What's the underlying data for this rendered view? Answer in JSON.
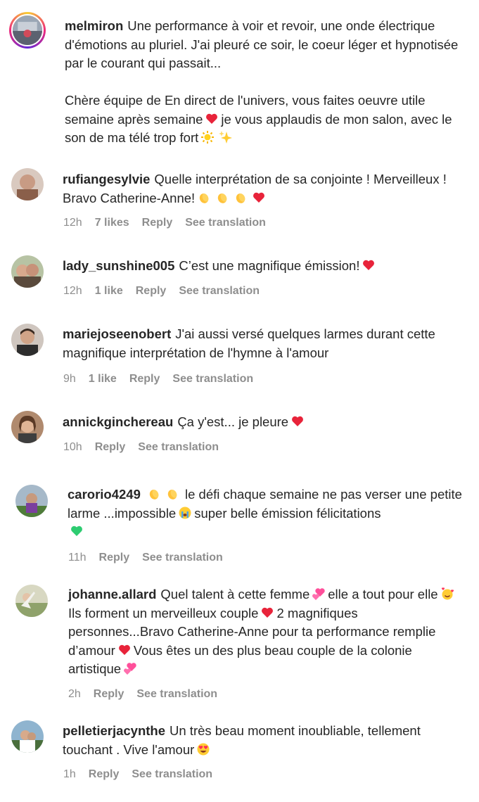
{
  "comments": [
    {
      "username": "melmiron",
      "text_1": "Une performance à voir et revoir, une onde électrique d'émotions au pluriel. J'ai pleuré ce soir, le coeur léger et hypnotisée par le courant qui passait...",
      "text_2": "Chère équipe de En direct de l'univers, vous faites oeuvre utile semaine après semaine",
      "text_3": "je vous applaudis de mon salon, avec le son de ma télé trop fort",
      "emojis": [
        "red-heart",
        "sun",
        "sparkles"
      ]
    },
    {
      "username": "rufiangesylvie",
      "text_1": "Quelle interprétation de sa conjointe ! Merveilleux ! Bravo Catherine-Anne!",
      "emojis": [
        "clapping-hands",
        "clapping-hands",
        "clapping-hands",
        "red-heart"
      ],
      "time": "12h",
      "likes": "7 likes",
      "reply": "Reply",
      "translate": "See translation"
    },
    {
      "username": "lady_sunshine005",
      "text_1": "C’est une magnifique émission!",
      "emojis": [
        "red-heart"
      ],
      "time": "12h",
      "likes": "1 like",
      "reply": "Reply",
      "translate": "See translation"
    },
    {
      "username": "mariejoseenobert",
      "text_1": "J'ai aussi versé quelques larmes durant cette magnifique interprétation de l'hymne à l'amour",
      "time": "9h",
      "likes": "1 like",
      "reply": "Reply",
      "translate": "See translation"
    },
    {
      "username": "annickginchereau",
      "text_1": "Ça y'est... je pleure",
      "emojis": [
        "red-heart"
      ],
      "time": "10h",
      "reply": "Reply",
      "translate": "See translation"
    },
    {
      "username": "carorio4249",
      "text_1": "le défi chaque semaine ne pas verser une petite larme ...impossible",
      "text_2": "super belle émission félicitations",
      "emojis": [
        "clapping-hands",
        "clapping-hands",
        "crying-face",
        "green-heart"
      ],
      "time": "11h",
      "reply": "Reply",
      "translate": "See translation"
    },
    {
      "username": "johanne.allard",
      "text_1": "Quel talent à cette femme",
      "text_2": "elle a tout pour elle",
      "text_3": "Ils forment un merveilleux couple",
      "text_4": "2 magnifiques personnes...Bravo Catherine-Anne pour ta performance remplie d’amour",
      "text_5": "Vous êtes un des plus beau couple de la colonie artistique",
      "emojis": [
        "two-hearts",
        "smiling-face-with-hearts",
        "red-heart",
        "red-heart",
        "two-hearts"
      ],
      "time": "2h",
      "reply": "Reply",
      "translate": "See translation"
    },
    {
      "username": "pelletierjacynthe",
      "text_1": "Un très beau moment inoubliable, tellement touchant . Vive l'amour",
      "emojis": [
        "heart-eyes"
      ],
      "time": "1h",
      "reply": "Reply",
      "translate": "See translation"
    }
  ],
  "colors": {
    "text": "#262626",
    "meta": "#8e8e8e",
    "heart_red": "#e8233a",
    "heart_green": "#2ecc71"
  }
}
